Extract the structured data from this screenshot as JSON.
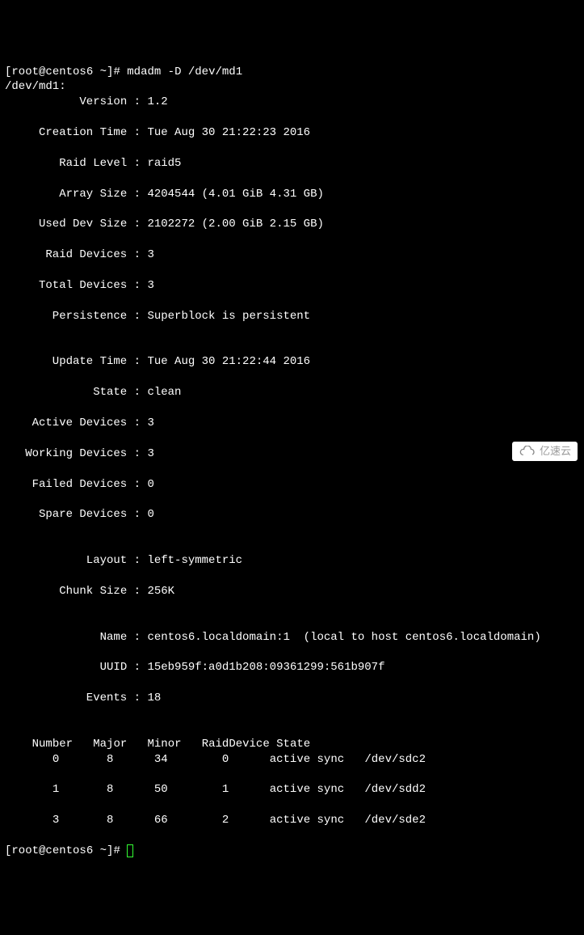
{
  "prompt_user": "root",
  "prompt_host": "centos6",
  "prompt_dir": "~",
  "command": "mdadm -D /dev/md1",
  "device_path": "/dev/md1:",
  "fields": {
    "version": {
      "label": "Version",
      "value": "1.2"
    },
    "creation_time": {
      "label": "Creation Time",
      "value": "Tue Aug 30 21:22:23 2016"
    },
    "raid_level": {
      "label": "Raid Level",
      "value": "raid5"
    },
    "array_size": {
      "label": "Array Size",
      "value": "4204544 (4.01 GiB 4.31 GB)"
    },
    "used_dev_size": {
      "label": "Used Dev Size",
      "value": "2102272 (2.00 GiB 2.15 GB)"
    },
    "raid_devices": {
      "label": "Raid Devices",
      "value": "3"
    },
    "total_devices": {
      "label": "Total Devices",
      "value": "3"
    },
    "persistence": {
      "label": "Persistence",
      "value": "Superblock is persistent"
    },
    "update_time": {
      "label": "Update Time",
      "value": "Tue Aug 30 21:22:44 2016"
    },
    "state": {
      "label": "State",
      "value": "clean"
    },
    "active_devices": {
      "label": "Active Devices",
      "value": "3"
    },
    "working_devices": {
      "label": "Working Devices",
      "value": "3"
    },
    "failed_devices": {
      "label": "Failed Devices",
      "value": "0"
    },
    "spare_devices": {
      "label": "Spare Devices",
      "value": "0"
    },
    "layout": {
      "label": "Layout",
      "value": "left-symmetric"
    },
    "chunk_size": {
      "label": "Chunk Size",
      "value": "256K"
    },
    "name": {
      "label": "Name",
      "value": "centos6.localdomain:1  (local to host centos6.localdomain)"
    },
    "uuid": {
      "label": "UUID",
      "value": "15eb959f:a0d1b208:09361299:561b907f"
    },
    "events": {
      "label": "Events",
      "value": "18"
    }
  },
  "table": {
    "headers": {
      "number": "Number",
      "major": "Major",
      "minor": "Minor",
      "raid_device": "RaidDevice",
      "state": "State"
    },
    "rows": [
      {
        "number": "0",
        "major": "8",
        "minor": "34",
        "raid_device": "0",
        "state": "active sync",
        "dev": "/dev/sdc2"
      },
      {
        "number": "1",
        "major": "8",
        "minor": "50",
        "raid_device": "1",
        "state": "active sync",
        "dev": "/dev/sdd2"
      },
      {
        "number": "3",
        "major": "8",
        "minor": "66",
        "raid_device": "2",
        "state": "active sync",
        "dev": "/dev/sde2"
      }
    ]
  },
  "watermark": "亿速云"
}
